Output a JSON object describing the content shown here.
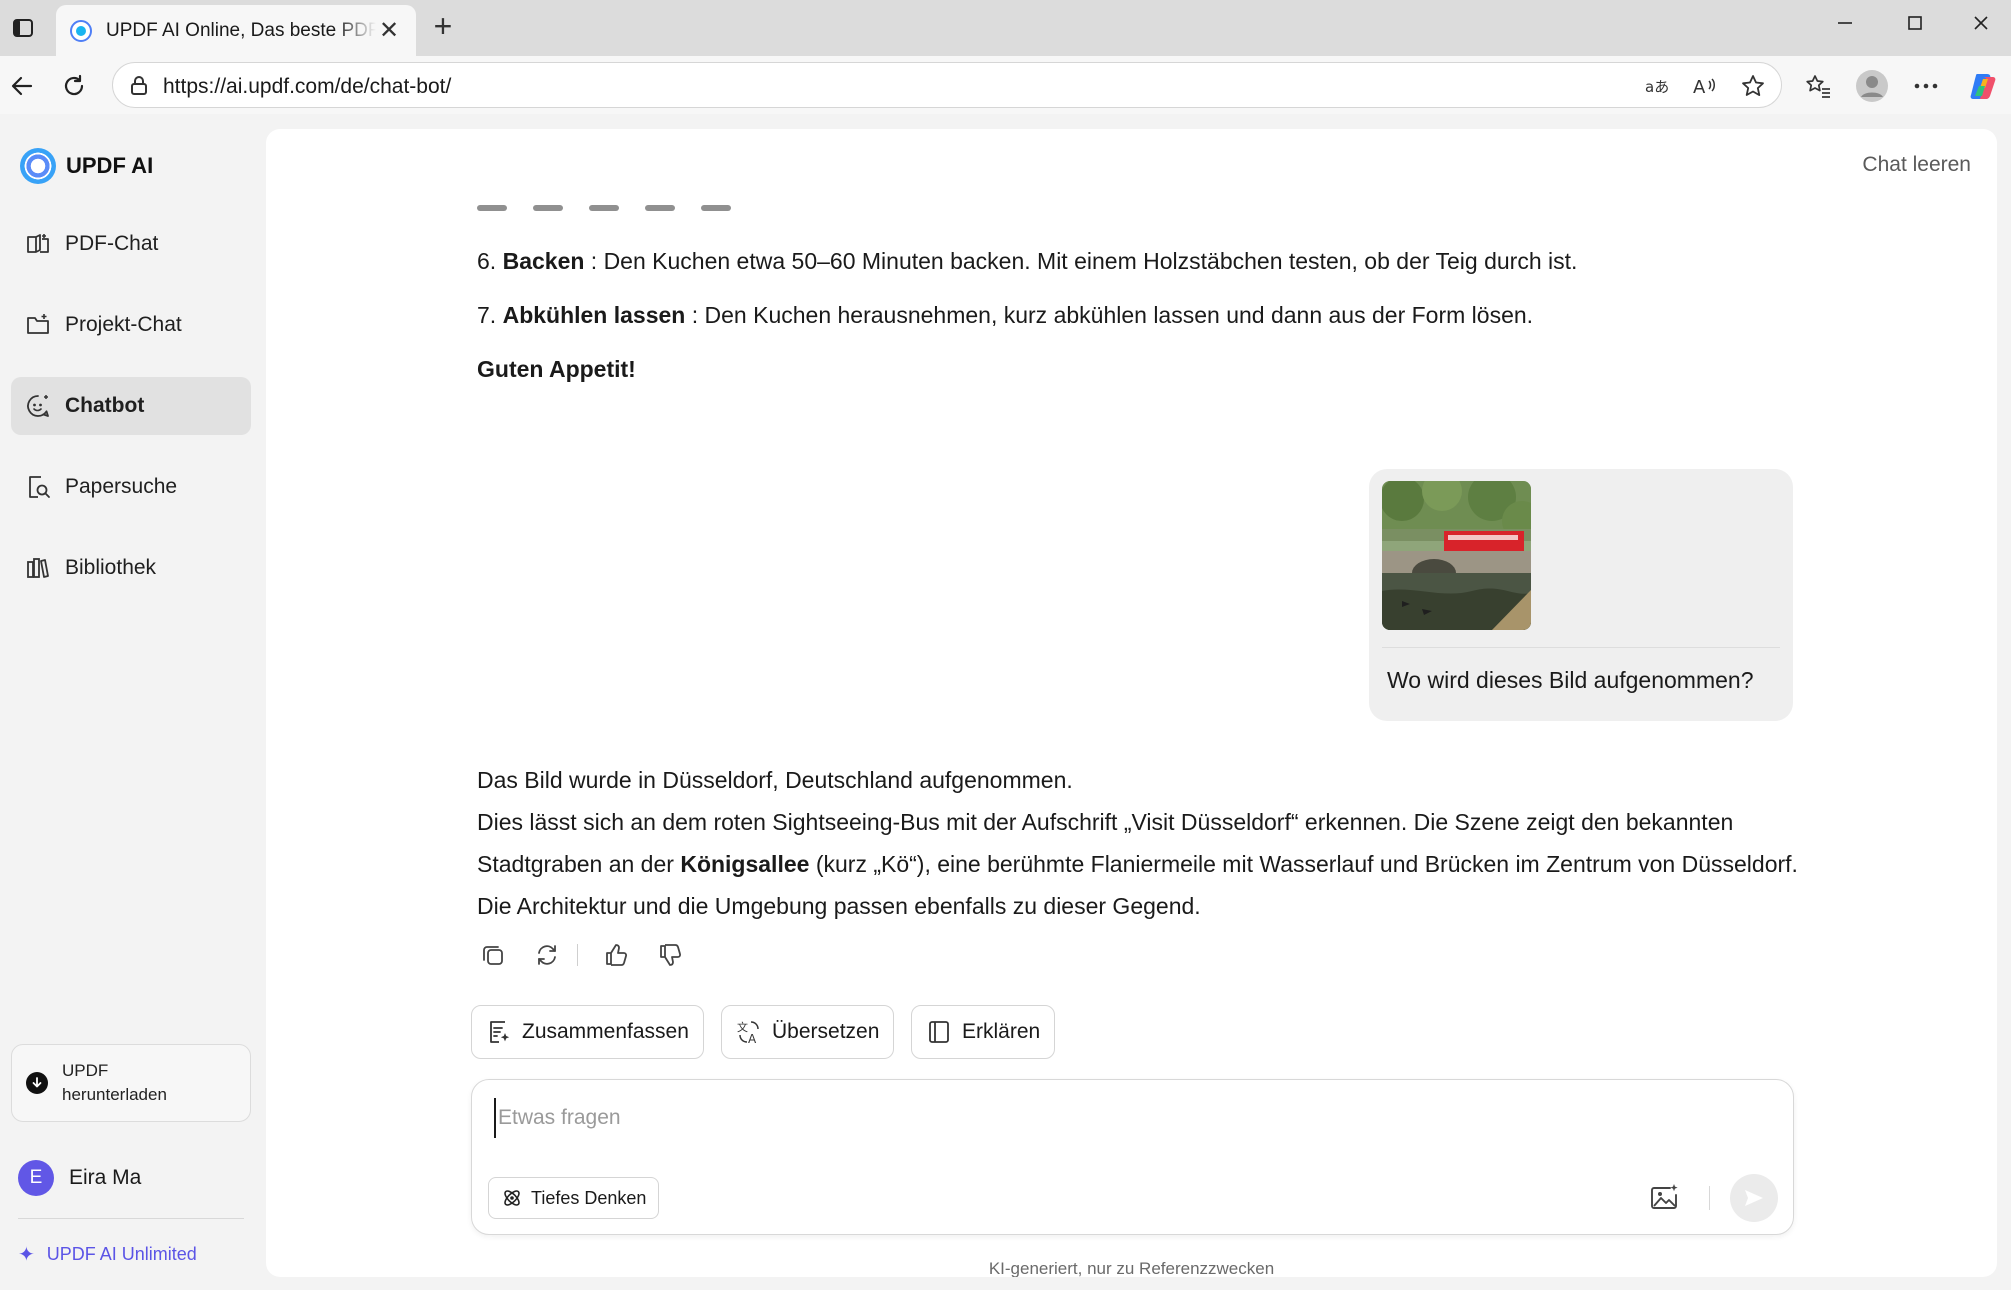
{
  "browser": {
    "tab_title": "UPDF AI Online, Das beste PDF-AI",
    "tab_close": "✕",
    "new_tab": "+",
    "url": "https://ai.updf.com/de/chat-bot/"
  },
  "sidebar": {
    "brand": "UPDF AI",
    "items": [
      {
        "label": "PDF-Chat",
        "icon": "book-open-icon",
        "active": false
      },
      {
        "label": "Projekt-Chat",
        "icon": "folder-icon",
        "active": false
      },
      {
        "label": "Chatbot",
        "icon": "chatbot-icon",
        "active": true
      },
      {
        "label": "Papersuche",
        "icon": "paper-search-icon",
        "active": false
      },
      {
        "label": "Bibliothek",
        "icon": "library-icon",
        "active": false
      }
    ],
    "download_label": "UPDF herunterladen",
    "user_initial": "E",
    "user_name": "Eira Ma",
    "unlimited_label": "UPDF AI Unlimited"
  },
  "main": {
    "clear_chat": "Chat leeren",
    "steps": [
      {
        "num": "6.",
        "title": "Backen",
        "text": " : Den Kuchen etwa 50–60 Minuten backen. Mit einem Holzstäbchen testen, ob der Teig durch ist."
      },
      {
        "num": "7.",
        "title": "Abkühlen lassen",
        "text": " : Den Kuchen herausnehmen, kurz abkühlen lassen und dann aus der Form lösen."
      }
    ],
    "closing": "Guten Appetit!",
    "user_question": "Wo wird dieses Bild aufgenommen?",
    "answer": {
      "line1": "Das Bild wurde in Düsseldorf, Deutschland aufgenommen.",
      "line2_pre": "Dies lässt sich an dem roten Sightseeing-Bus mit der Aufschrift „Visit Düsseldorf“ erkennen. Die Szene zeigt den bekannten Stadtgraben an der ",
      "line2_bold": "Königsallee",
      "line2_post": " (kurz „Kö“), eine berühmte Flaniermeile mit Wasserlauf und Brücken im Zentrum von Düsseldorf. Die Architektur und die Umgebung passen ebenfalls zu dieser Gegend."
    },
    "chips": [
      {
        "label": "Zusammenfassen"
      },
      {
        "label": "Übersetzen"
      },
      {
        "label": "Erklären"
      }
    ],
    "input_placeholder": "Etwas fragen",
    "deep_think": "Tiefes Denken",
    "disclaimer": "KI-generiert, nur zu Referenzzwecken"
  },
  "colors": {
    "accent": "#5b54e6",
    "avatar": "#6157e6",
    "active_nav": "#e1e1e1",
    "bubble": "#efefef"
  }
}
